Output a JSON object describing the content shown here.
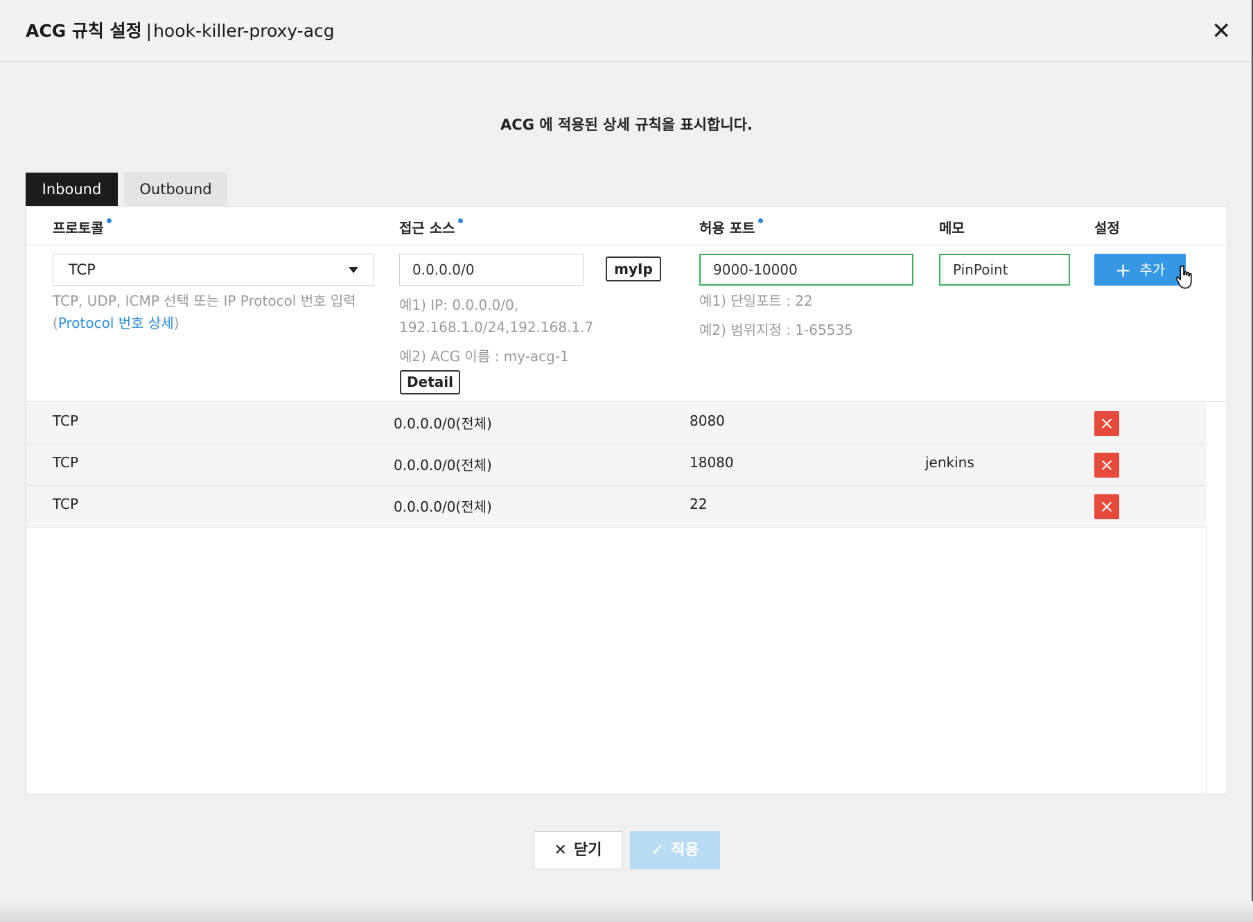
{
  "header": {
    "title_main": "ACG 규칙 설정",
    "title_sep": "|",
    "title_sub": "hook-killer-proxy-acg",
    "close_glyph": "✕"
  },
  "description": "ACG 에 적용된 상세 규칙을 표시합니다.",
  "tabs": [
    {
      "label": "Inbound",
      "active": true
    },
    {
      "label": "Outbound",
      "active": false
    }
  ],
  "columns": {
    "protocol": "프로토콜",
    "source": "접근 소스",
    "port": "허용 포트",
    "memo": "메모",
    "settings": "설정"
  },
  "form": {
    "protocol_value": "TCP",
    "protocol_hint": "TCP, UDP, ICMP 선택 또는 IP Protocol 번호 입력",
    "protocol_hint_link_open": "(",
    "protocol_hint_link": "Protocol 번호 상세",
    "protocol_hint_link_close": ")",
    "source_value": "0.0.0.0/0",
    "myip_label": "myIp",
    "source_hint1_line1": "예1) IP: 0.0.0.0/0,",
    "source_hint1_line2": "192.168.1.0/24,192.168.1.7",
    "source_hint2": "예2) ACG 이름 : my-acg-1",
    "detail_label": "Detail",
    "port_value": "9000-10000",
    "port_hint1": "예1) 단일포트 : 22",
    "port_hint2": "예2) 범위지정 : 1-65535",
    "memo_value": "PinPoint",
    "add_label": "추가",
    "add_glyph": "+"
  },
  "rules": [
    {
      "protocol": "TCP",
      "source": "0.0.0.0/0(전체)",
      "port": "8080",
      "memo": ""
    },
    {
      "protocol": "TCP",
      "source": "0.0.0.0/0(전체)",
      "port": "18080",
      "memo": "jenkins"
    },
    {
      "protocol": "TCP",
      "source": "0.0.0.0/0(전체)",
      "port": "22",
      "memo": ""
    }
  ],
  "footer": {
    "close_label": "닫기",
    "close_glyph": "✕",
    "apply_label": "적용",
    "apply_glyph": "✓"
  },
  "colors": {
    "add_button": "#3597e6",
    "delete_button": "#e64b3c",
    "valid_border": "#3cae5a",
    "required_dot": "#2e86de",
    "link": "#2e8fd6",
    "apply_disabled": "#b9dcf4",
    "active_tab": "#1c1c1c"
  }
}
